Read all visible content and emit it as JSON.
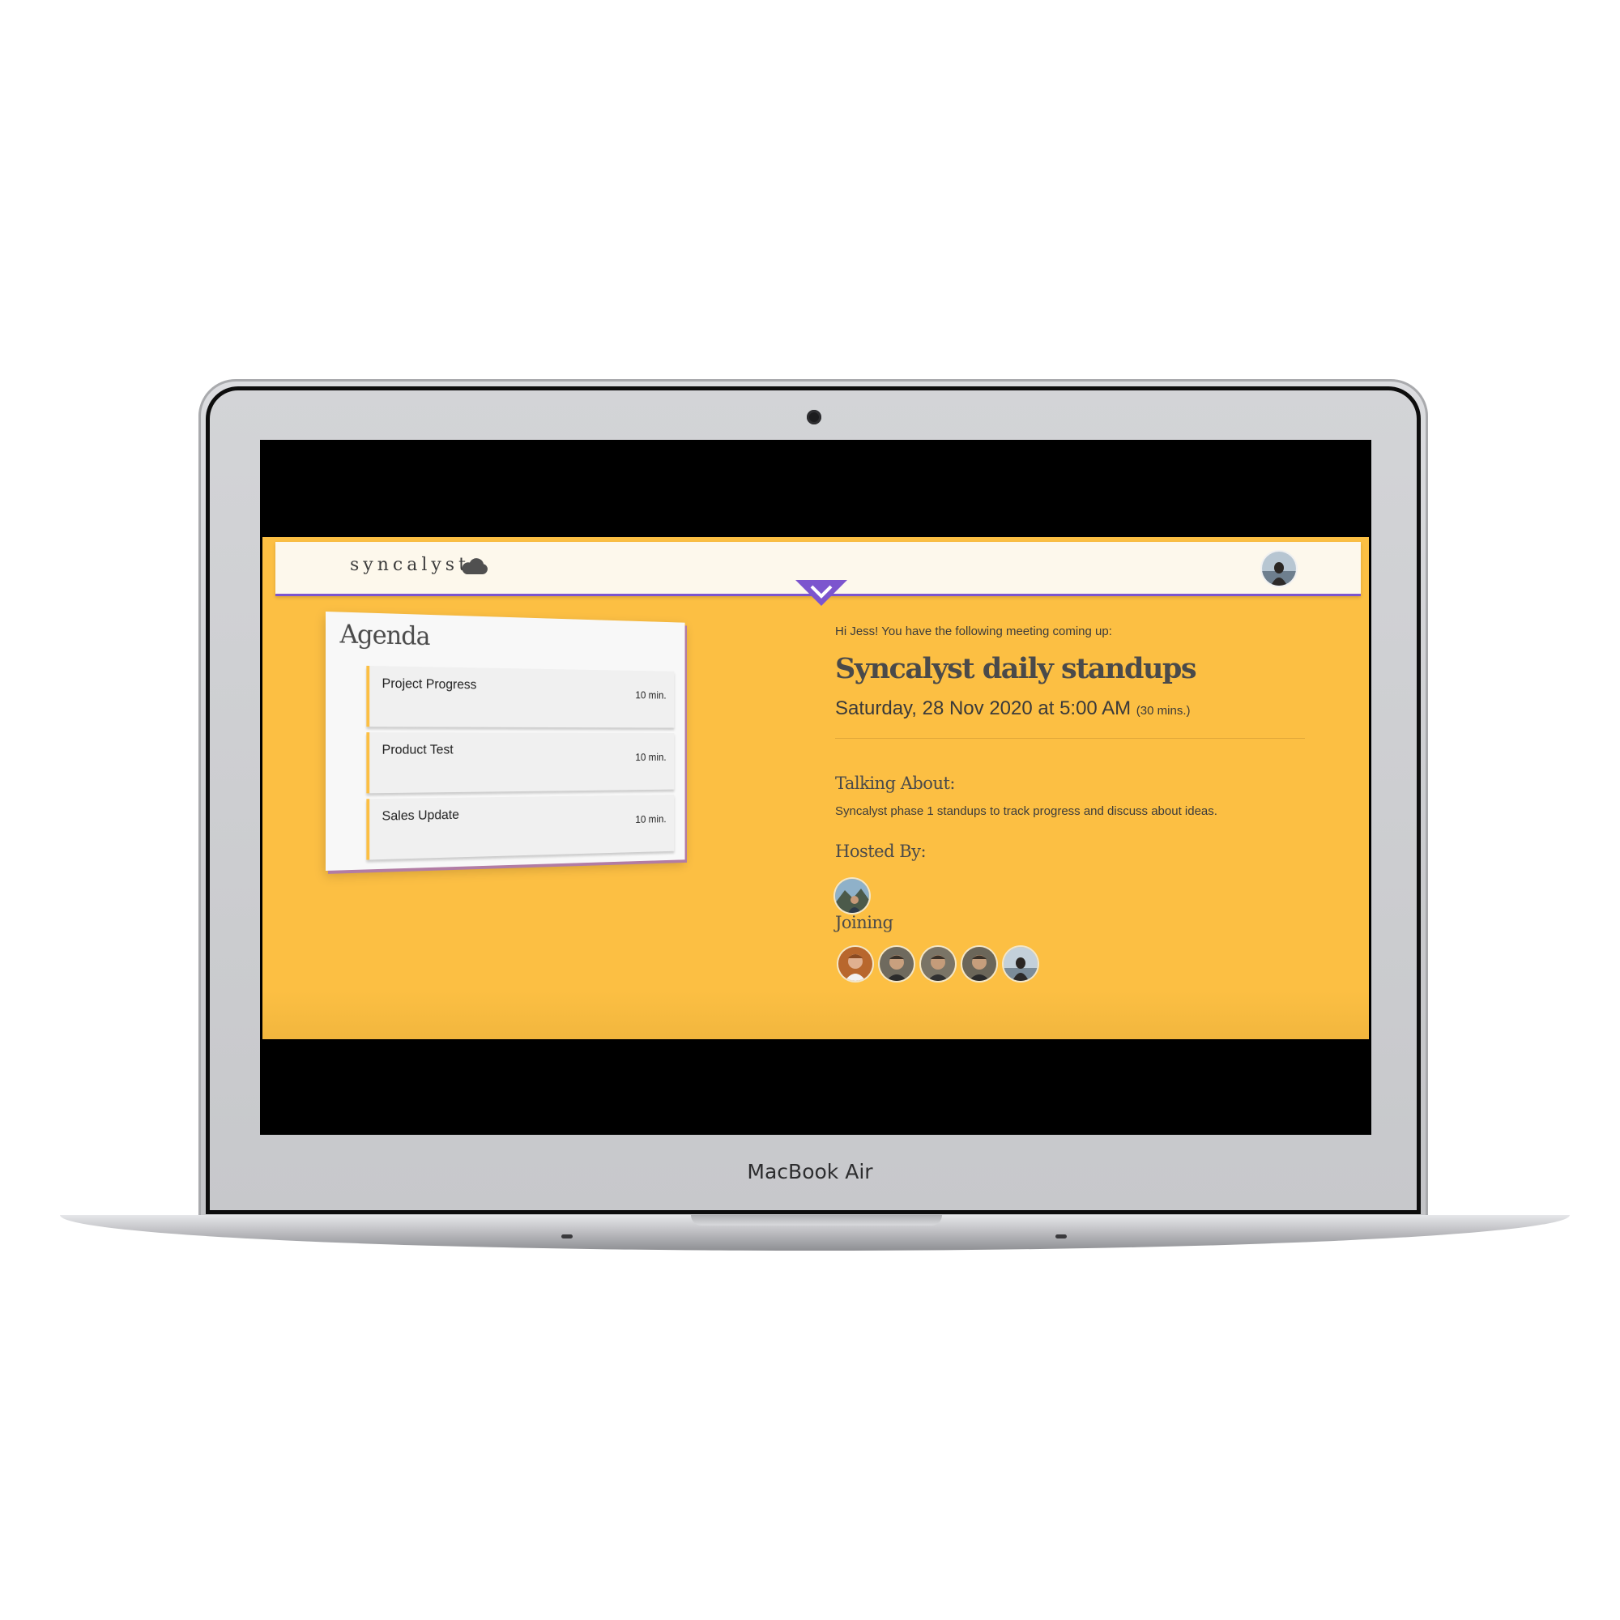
{
  "device": {
    "brand_label": "MacBook Air"
  },
  "navbar": {
    "logo_text": "syncalyst",
    "logo_icon": "cloud-icon",
    "toggle_icon": "chevron-down-icon",
    "accent_color": "#7c55ce"
  },
  "agenda": {
    "title": "Agenda",
    "items": [
      {
        "name": "Project Progress",
        "duration": "10 min."
      },
      {
        "name": "Product Test",
        "duration": "10 min."
      },
      {
        "name": "Sales Update",
        "duration": "10 min."
      }
    ]
  },
  "meeting": {
    "greeting": "Hi Jess! You have the following meeting coming up:",
    "title": "Syncalyst daily standups",
    "date": "Saturday, 28 Nov 2020 at 5:00 AM",
    "duration": "(30 mins.)",
    "topic_label": "Talking About:",
    "topic": "Syncalyst phase 1 standups to track progress and discuss about ideas.",
    "hosted_label": "Hosted By:",
    "joining_label": "Joining"
  },
  "colors": {
    "background": "#fcbf43",
    "navbar": "#fdf8ec",
    "card": "#f8f8f8"
  }
}
